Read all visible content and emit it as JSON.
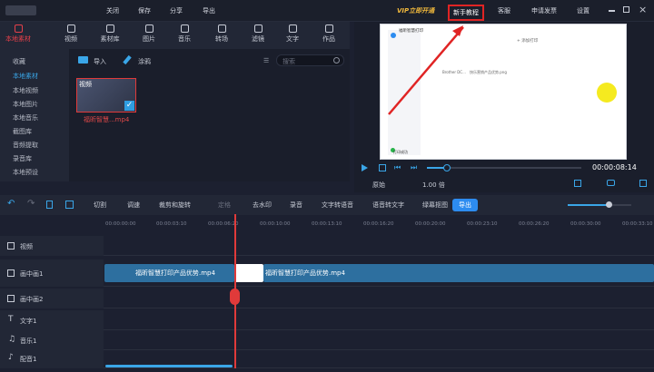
{
  "topbar": {
    "menus": [
      "关闭",
      "保存",
      "分享",
      "导出"
    ],
    "vip": "VIP立即开通",
    "tutorial": "新手教程",
    "service": "客服",
    "invoice": "申请发票",
    "settings": "设置"
  },
  "media_tabs": [
    "本地素材",
    "视频",
    "素材库",
    "图片",
    "音乐",
    "转场",
    "滤镜",
    "文字",
    "作品"
  ],
  "sidebar": [
    "收藏",
    "本地素材",
    "本地视频",
    "本地图片",
    "本地音乐",
    "截图库",
    "音频提取",
    "录音库",
    "本地预设"
  ],
  "library": {
    "import": "导入",
    "paint": "涂鸦",
    "search_placeholder": "搜索",
    "thumb_label": "视频",
    "file_name": "福昕智慧...mp4"
  },
  "preview_screen": {
    "app_title": "福昕智慧打印",
    "add_print": "+ 添加打印",
    "doc_name": "Brother DC...",
    "doc_file": "快乐营销产品优势.png",
    "status": "打印成功"
  },
  "player": {
    "time": "00:00:08:14",
    "ratio": "原始",
    "speed": "1.00 倍"
  },
  "toolbar": [
    "切割",
    "调速",
    "裁剪和旋转",
    "定格",
    "去水印",
    "录音",
    "文字转语音",
    "语音转文字",
    "绿幕抠图"
  ],
  "export": "导出",
  "ruler": [
    "00:00:00:00",
    "00:00:03:10",
    "00:00:06:20",
    "00:00:10:00",
    "00:00:13:10",
    "00:00:16:20",
    "00:00:20:00",
    "00:00:23:10",
    "00:00:26:20",
    "00:00:30:00",
    "00:00:33:10"
  ],
  "tracks": [
    "视频",
    "画中画1",
    "画中画2",
    "文字1",
    "音乐1",
    "配音1"
  ],
  "clips": {
    "a": "福昕智慧打印产品优势.mp4",
    "b": "福昕智慧打印产品优势.mp4"
  }
}
